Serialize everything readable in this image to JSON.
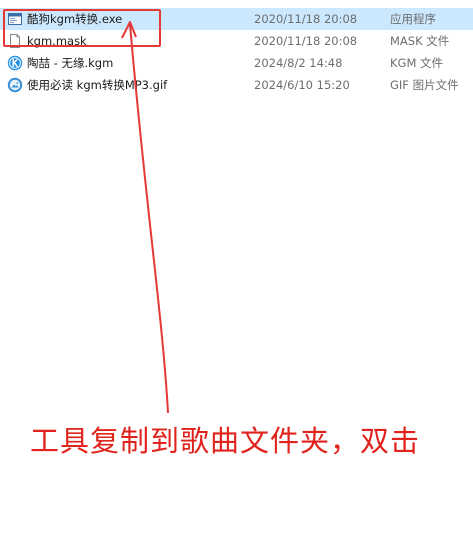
{
  "files": [
    {
      "name": "酷狗kgm转换.exe",
      "date": "2020/11/18 20:08",
      "type": "应用程序",
      "icon": "exe-app-icon",
      "selected": true
    },
    {
      "name": "kgm.mask",
      "date": "2020/11/18 20:08",
      "type": "MASK 文件",
      "icon": "blank-file-icon",
      "selected": false
    },
    {
      "name": "陶喆 - 无缘.kgm",
      "date": "2024/8/2 14:48",
      "type": "KGM 文件",
      "icon": "kugou-k-icon",
      "selected": false
    },
    {
      "name": "使用必读 kgm转换MP3.gif",
      "date": "2024/6/10 15:20",
      "type": "GIF 图片文件",
      "icon": "gif-image-icon",
      "selected": false
    }
  ],
  "annotation": {
    "instruction": "工具复制到歌曲文件夹，双击",
    "color": "#e0231c"
  },
  "colors": {
    "selection": "#cce8ff",
    "highlight_border": "#e53935"
  }
}
